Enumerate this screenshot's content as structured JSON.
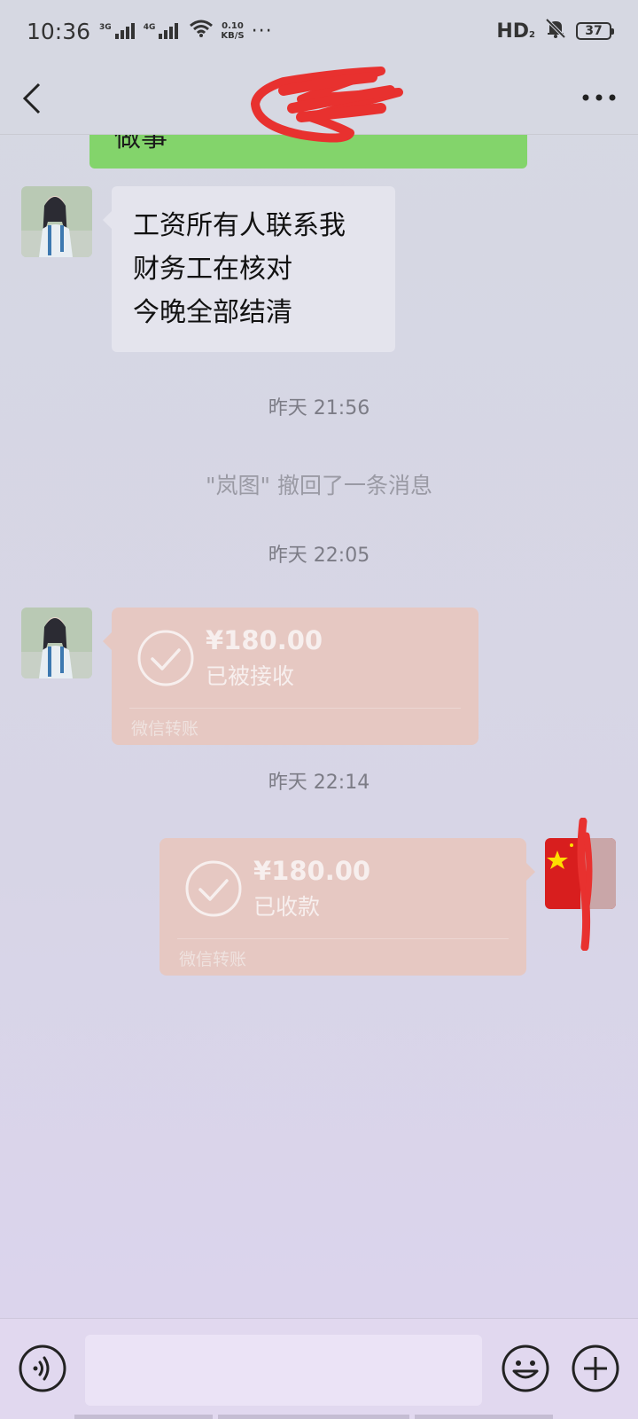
{
  "status_bar": {
    "time": "10:36",
    "signal1_label": "3G",
    "signal2_label": "4G",
    "speed_value": "0.10",
    "speed_unit": "KB/S",
    "more": "···",
    "hd_label": "HD",
    "hd_sub": "2",
    "battery": "37"
  },
  "header": {
    "back_icon": "chevron-left-icon",
    "more_icon": "more-horizontal-icon"
  },
  "messages": {
    "partial_bubble_text": "做事",
    "text_bubble_lines": [
      "工资所有人联系我",
      "财务工在核对",
      "今晚全部结清"
    ],
    "time1": "昨天 21:56",
    "recall_note": "\"岚图\" 撤回了一条消息",
    "time2": "昨天 22:05",
    "transfer1": {
      "amount": "¥180.00",
      "status": "已被接收",
      "source": "微信转账"
    },
    "time3": "昨天 22:14",
    "transfer2": {
      "amount": "¥180.00",
      "status": "已收款",
      "source": "微信转账"
    }
  },
  "input_bar": {
    "voice_icon": "voice-icon",
    "emoji_icon": "emoji-icon",
    "plus_icon": "plus-circle-icon"
  },
  "colors": {
    "sent_bubble": "#83d46b",
    "received_bubble": "#e4e4ed",
    "transfer_card": "#e6c8c2",
    "redaction": "#e8312f"
  }
}
